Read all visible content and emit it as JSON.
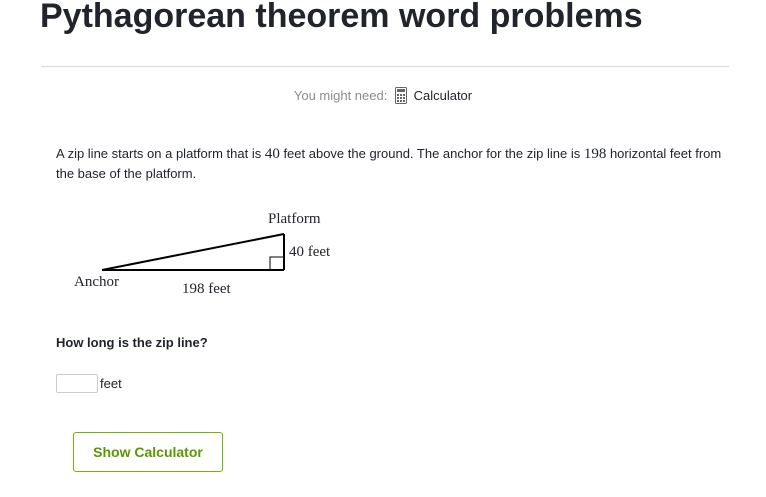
{
  "page": {
    "title": "Pythagorean theorem word problems"
  },
  "tools": {
    "label": "You might need:",
    "calculator_icon": "calculator-icon",
    "calculator_link": "Calculator"
  },
  "problem": {
    "text_1": "A zip line starts on a platform that is ",
    "height_value": "40",
    "text_2": " feet above the ground. The anchor for the zip line is ",
    "distance_value": "198",
    "text_3": " horizontal feet from the base of the platform."
  },
  "diagram": {
    "platform_label": "Platform",
    "height_label": "40 feet",
    "anchor_label": "Anchor",
    "base_label": "198 feet"
  },
  "question": {
    "text": "How long is the zip line?",
    "answer_value": "",
    "unit": "feet"
  },
  "buttons": {
    "show_calculator": "Show Calculator"
  },
  "colors": {
    "accent_green": "#71b307",
    "button_text_green": "#5d9603",
    "title_text": "#21242c",
    "muted_text": "#888d93"
  }
}
